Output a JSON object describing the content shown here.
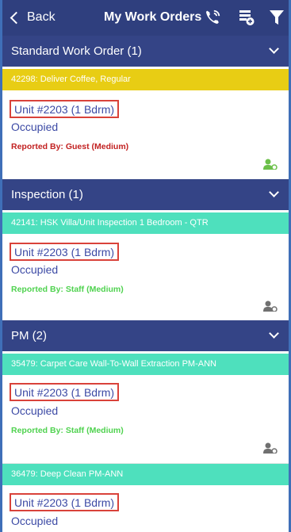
{
  "header": {
    "back_label": "Back",
    "title": "My Work Orders",
    "icons": [
      "phone-icon",
      "add-list-icon",
      "filter-icon"
    ]
  },
  "colors": {
    "header_bg": "#2f3f7e",
    "section_bg": "#344486",
    "strip_yellow": "#e8cd14",
    "strip_teal": "#4ee0bd",
    "highlight_red": "#d9423a",
    "link_blue": "#3c4aa5",
    "reported_guest": "#c22121",
    "reported_staff": "#4fd24f",
    "assign_icon_green": "#6cc04a",
    "assign_icon_gray": "#707070"
  },
  "sections": [
    {
      "label": "Standard Work Order (1)",
      "orders": [
        {
          "strip": "42298: Deliver Coffee, Regular",
          "unit": "Unit #2203 (1 Bdrm)",
          "status": "Occupied",
          "reported": "Reported By: Guest  (Medium)"
        }
      ]
    },
    {
      "label": "Inspection (1)",
      "orders": [
        {
          "strip": "42141: HSK  Villa/Unit Inspection 1 Bedroom - QTR",
          "unit": "Unit #2203 (1 Bdrm)",
          "status": "Occupied",
          "reported": "Reported By: Staff  (Medium)"
        }
      ]
    },
    {
      "label": "PM (2)",
      "orders": [
        {
          "strip": "35479:  Carpet Care Wall-To-Wall Extraction PM-ANN",
          "unit": "Unit #2203 (1 Bdrm)",
          "status": "Occupied",
          "reported": "Reported By: Staff  (Medium)"
        },
        {
          "strip": "36479:  Deep Clean PM-ANN",
          "unit": "Unit #2203 (1 Bdrm)",
          "status": "Occupied"
        }
      ]
    }
  ]
}
